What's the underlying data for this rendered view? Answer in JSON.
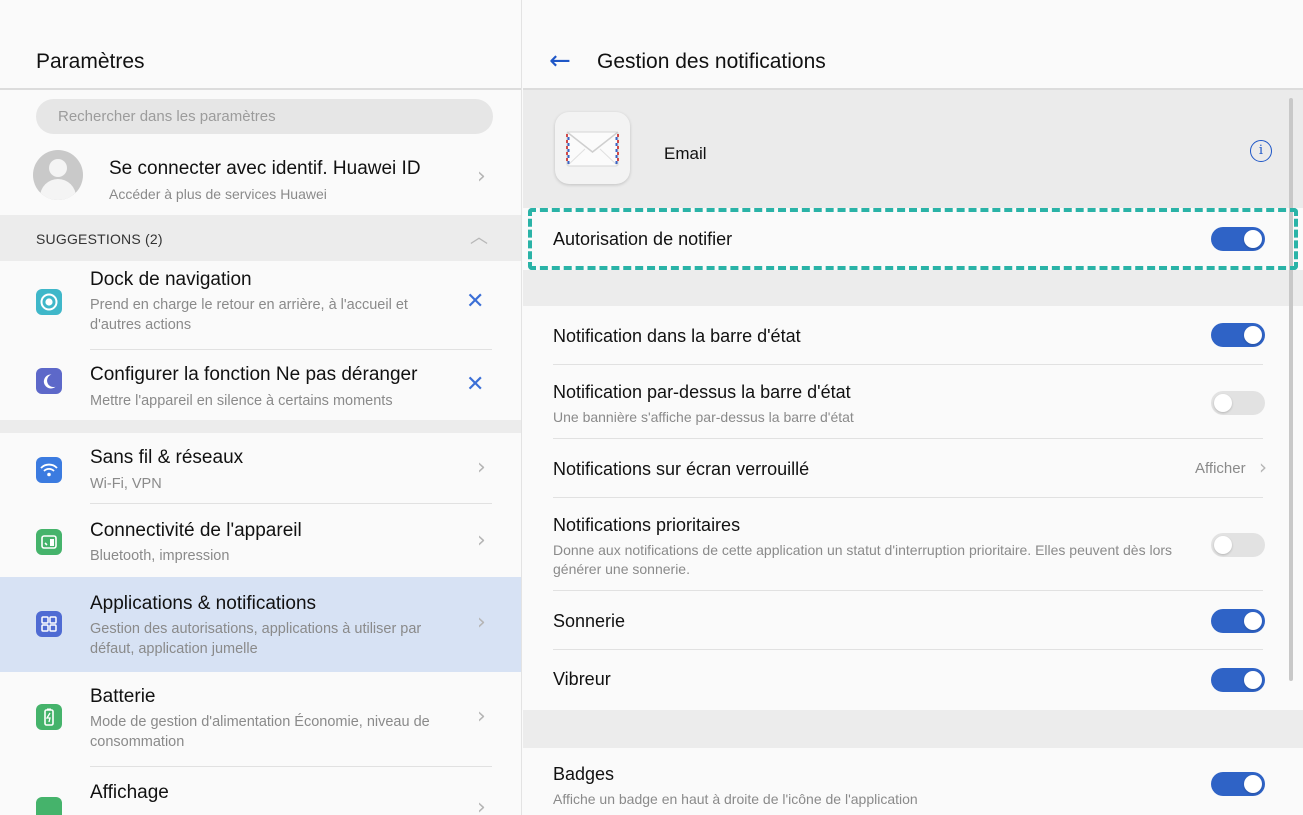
{
  "settings": {
    "title": "Paramètres",
    "search_placeholder": "Rechercher dans les paramètres",
    "account": {
      "title": "Se connecter avec identif. Huawei ID",
      "subtitle": "Accéder à plus de services Huawei"
    },
    "suggestions": {
      "header": "SUGGESTIONS (2)",
      "items": [
        {
          "title": "Dock de navigation",
          "subtitle": "Prend en charge le retour en arrière, à l'accueil et d'autres actions",
          "icon": "navigation-dock-icon"
        },
        {
          "title": "Configurer la fonction Ne pas déranger",
          "subtitle": "Mettre l'appareil en silence à certains moments",
          "icon": "moon-icon"
        }
      ]
    },
    "items": [
      {
        "title": "Sans fil & réseaux",
        "subtitle": "Wi-Fi, VPN",
        "icon": "wifi-icon"
      },
      {
        "title": "Connectivité de l'appareil",
        "subtitle": "Bluetooth, impression",
        "icon": "device-connectivity-icon"
      },
      {
        "title": "Applications & notifications",
        "subtitle": "Gestion des autorisations, applications à utiliser par défaut, application jumelle",
        "icon": "apps-grid-icon",
        "selected": true
      },
      {
        "title": "Batterie",
        "subtitle": "Mode de gestion d'alimentation Économie, niveau de consommation",
        "icon": "battery-icon"
      },
      {
        "title": "Affichage",
        "subtitle": "",
        "icon": "display-icon"
      }
    ]
  },
  "notifications": {
    "title": "Gestion des notifications",
    "app_name": "Email",
    "allow": {
      "label": "Autorisation de notifier",
      "on": true
    },
    "rows": [
      {
        "label": "Notification dans la barre d'état",
        "on": true
      },
      {
        "label": "Notification par-dessus la barre d'état",
        "sub": "Une bannière s'affiche par-dessus la barre d'état",
        "on": false
      },
      {
        "label": "Notifications sur écran verrouillé",
        "value": "Afficher"
      },
      {
        "label": "Notifications prioritaires",
        "sub": "Donne aux notifications de cette application un statut d'interruption prioritaire. Elles peuvent dès lors générer une sonnerie.",
        "on": false
      },
      {
        "label": "Sonnerie",
        "on": true
      },
      {
        "label": "Vibreur",
        "on": true
      }
    ],
    "badges": {
      "label": "Badges",
      "sub": "Affiche un badge en haut à droite de l'icône de l'application",
      "on": true
    }
  },
  "colors": {
    "accent": "#2f63c6",
    "highlight": "#2ab3a7",
    "selected_row": "#d7e2f4"
  }
}
